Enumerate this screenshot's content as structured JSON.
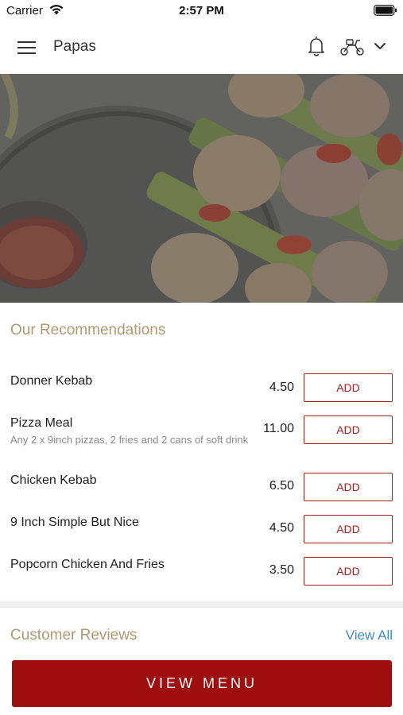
{
  "status_bar": {
    "carrier": "Carrier",
    "time": "2:57 PM"
  },
  "header": {
    "title": "Papas",
    "icons": [
      "menu-icon",
      "bell-icon",
      "scooter-icon",
      "chevron-down-icon"
    ]
  },
  "recommendations": {
    "title": "Our Recommendations",
    "add_label": "ADD",
    "items": [
      {
        "name": "Donner Kebab",
        "description": "",
        "price": "4.50"
      },
      {
        "name": "Pizza Meal",
        "description": "Any 2 x 9inch pizzas, 2 fries and 2 cans of soft drink",
        "price": "11.00"
      },
      {
        "name": "Chicken Kebab",
        "description": "",
        "price": "6.50"
      },
      {
        "name": "9 Inch Simple But Nice",
        "description": "",
        "price": "4.50"
      },
      {
        "name": "Popcorn Chicken And Fries",
        "description": "",
        "price": "3.50"
      }
    ]
  },
  "reviews": {
    "title": "Customer Reviews",
    "view_all": "View All"
  },
  "footer": {
    "view_menu": "VIEW MENU"
  },
  "colors": {
    "accent": "#a51f1f",
    "section_title": "#b09a72",
    "link": "#3b8fbf",
    "primary_button": "#9f0e0e"
  }
}
